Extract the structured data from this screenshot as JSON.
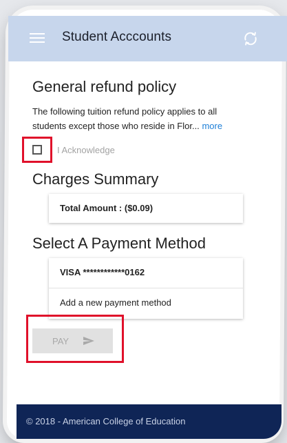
{
  "app_bar": {
    "title": "Student Acccounts",
    "menu_icon": "hamburger-menu-icon",
    "refresh_icon": "refresh-icon"
  },
  "refund_policy": {
    "heading": "General refund policy",
    "text": "The following tuition refund policy applies to all students except those who reside in Flor...",
    "more_link": "more",
    "acknowledge_label": "I Acknowledge",
    "acknowledged": false
  },
  "charges_summary": {
    "heading": "Charges Summary",
    "total": "Total Amount : ($0.09)"
  },
  "payment": {
    "heading": "Select A Payment Method",
    "methods": [
      "VISA ************0162",
      "Add a new payment method"
    ],
    "pay_button_label": "PAY",
    "pay_icon": "send-icon"
  },
  "footer": {
    "text": "© 2018 - American College of Education"
  },
  "colors": {
    "app_bar": "#c7d6ec",
    "footer": "#0f2556",
    "link": "#1e7fd7",
    "highlight": "#e0102a"
  }
}
